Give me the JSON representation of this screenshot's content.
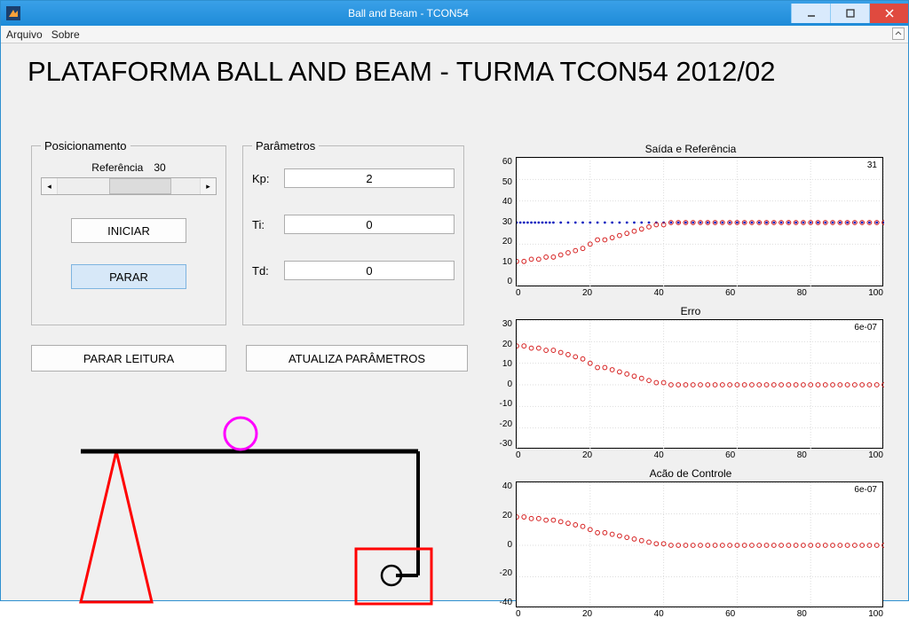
{
  "window": {
    "title": "Ball and Beam - TCON54"
  },
  "menubar": {
    "file": "Arquivo",
    "about": "Sobre"
  },
  "header": {
    "title": "PLATAFORMA BALL AND BEAM - TURMA TCON54 2012/02"
  },
  "positioning": {
    "legend": "Posicionamento",
    "reference_label": "Referência",
    "reference_value": "30",
    "start_btn": "INICIAR",
    "stop_btn": "PARAR"
  },
  "parameters": {
    "legend": "Parâmetros",
    "kp_label": "Kp:",
    "kp_value": "2",
    "ti_label": "Ti:",
    "ti_value": "0",
    "td_label": "Td:",
    "td_value": "0"
  },
  "lower": {
    "stop_read": "PARAR LEITURA",
    "update_params": "ATUALIZA PARÂMETROS"
  },
  "chart_data": [
    {
      "type": "line",
      "title": "Saída e Referência",
      "xlim": [
        0,
        100
      ],
      "ylim": [
        0,
        60
      ],
      "yticks": [
        0,
        10,
        20,
        30,
        40,
        50,
        60
      ],
      "xticks": [
        0,
        20,
        40,
        60,
        80,
        100
      ],
      "annotation": "31",
      "series": [
        {
          "name": "Referência",
          "color": "#1020c0",
          "marker": "dot",
          "x": [
            0,
            1,
            2,
            3,
            4,
            5,
            6,
            7,
            8,
            9,
            10,
            12,
            14,
            16,
            18,
            20,
            22,
            24,
            26,
            28,
            30,
            32,
            34,
            36,
            38,
            40,
            42,
            44,
            46,
            48,
            50,
            52,
            54,
            56,
            58,
            60,
            62,
            64,
            66,
            68,
            70,
            72,
            74,
            76,
            78,
            80,
            82,
            84,
            86,
            88,
            90,
            92,
            94,
            96,
            98,
            100
          ],
          "y": [
            30,
            30,
            30,
            30,
            30,
            30,
            30,
            30,
            30,
            30,
            30,
            30,
            30,
            30,
            30,
            30,
            30,
            30,
            30,
            30,
            30,
            30,
            30,
            30,
            30,
            30,
            30,
            30,
            30,
            30,
            30,
            30,
            30,
            30,
            30,
            30,
            30,
            30,
            30,
            30,
            30,
            30,
            30,
            30,
            30,
            30,
            30,
            30,
            30,
            30,
            30,
            30,
            30,
            30,
            30,
            30
          ]
        },
        {
          "name": "Saída",
          "color": "#d62020",
          "marker": "circle",
          "x": [
            0,
            2,
            4,
            6,
            8,
            10,
            12,
            14,
            16,
            18,
            20,
            22,
            24,
            26,
            28,
            30,
            32,
            34,
            36,
            38,
            40,
            42,
            44,
            46,
            48,
            50,
            52,
            54,
            56,
            58,
            60,
            62,
            64,
            66,
            68,
            70,
            72,
            74,
            76,
            78,
            80,
            82,
            84,
            86,
            88,
            90,
            92,
            94,
            96,
            98,
            100
          ],
          "y": [
            12,
            12,
            13,
            13,
            14,
            14,
            15,
            16,
            17,
            18,
            20,
            22,
            22,
            23,
            24,
            25,
            26,
            27,
            28,
            29,
            29,
            30,
            30,
            30,
            30,
            30,
            30,
            30,
            30,
            30,
            30,
            30,
            30,
            30,
            30,
            30,
            30,
            30,
            30,
            30,
            30,
            30,
            30,
            30,
            30,
            30,
            30,
            30,
            30,
            30,
            30
          ]
        }
      ]
    },
    {
      "type": "line",
      "title": "Erro",
      "xlim": [
        0,
        100
      ],
      "ylim": [
        -30,
        30
      ],
      "yticks": [
        -30,
        -20,
        -10,
        0,
        10,
        20,
        30
      ],
      "xticks": [
        0,
        20,
        40,
        60,
        80,
        100
      ],
      "annotation": "6e-07",
      "series": [
        {
          "name": "Erro",
          "color": "#d62020",
          "marker": "circle",
          "x": [
            0,
            2,
            4,
            6,
            8,
            10,
            12,
            14,
            16,
            18,
            20,
            22,
            24,
            26,
            28,
            30,
            32,
            34,
            36,
            38,
            40,
            42,
            44,
            46,
            48,
            50,
            52,
            54,
            56,
            58,
            60,
            62,
            64,
            66,
            68,
            70,
            72,
            74,
            76,
            78,
            80,
            82,
            84,
            86,
            88,
            90,
            92,
            94,
            96,
            98,
            100
          ],
          "y": [
            18,
            18,
            17,
            17,
            16,
            16,
            15,
            14,
            13,
            12,
            10,
            8,
            8,
            7,
            6,
            5,
            4,
            3,
            2,
            1,
            1,
            0,
            0,
            0,
            0,
            0,
            0,
            0,
            0,
            0,
            0,
            0,
            0,
            0,
            0,
            0,
            0,
            0,
            0,
            0,
            0,
            0,
            0,
            0,
            0,
            0,
            0,
            0,
            0,
            0,
            0
          ]
        }
      ]
    },
    {
      "type": "line",
      "title": "Acão de Controle",
      "xlim": [
        0,
        100
      ],
      "ylim": [
        -40,
        40
      ],
      "yticks": [
        -40,
        -20,
        0,
        20,
        40
      ],
      "xticks": [
        0,
        20,
        40,
        60,
        80,
        100
      ],
      "annotation": "6e-07",
      "series": [
        {
          "name": "Controle",
          "color": "#d62020",
          "marker": "circle",
          "x": [
            0,
            2,
            4,
            6,
            8,
            10,
            12,
            14,
            16,
            18,
            20,
            22,
            24,
            26,
            28,
            30,
            32,
            34,
            36,
            38,
            40,
            42,
            44,
            46,
            48,
            50,
            52,
            54,
            56,
            58,
            60,
            62,
            64,
            66,
            68,
            70,
            72,
            74,
            76,
            78,
            80,
            82,
            84,
            86,
            88,
            90,
            92,
            94,
            96,
            98,
            100
          ],
          "y": [
            18,
            18,
            17,
            17,
            16,
            16,
            15,
            14,
            13,
            12,
            10,
            8,
            8,
            7,
            6,
            5,
            4,
            3,
            2,
            1,
            1,
            0,
            0,
            0,
            0,
            0,
            0,
            0,
            0,
            0,
            0,
            0,
            0,
            0,
            0,
            0,
            0,
            0,
            0,
            0,
            0,
            0,
            0,
            0,
            0,
            0,
            0,
            0,
            0,
            0,
            0
          ]
        }
      ]
    }
  ]
}
